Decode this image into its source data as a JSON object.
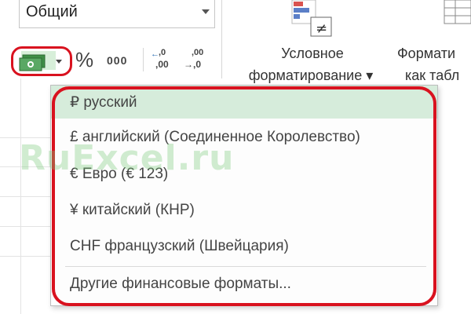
{
  "ribbon": {
    "number_format": {
      "value": "Общий"
    },
    "buttons": {
      "percent": "%",
      "thousands": "000",
      "increase_decimal_top": ",0",
      "increase_decimal_bottom": ",00",
      "decrease_decimal_top": ",00",
      "decrease_decimal_bottom": "→,0"
    },
    "conditional_formatting": {
      "line1": "Условное",
      "line2": "форматирование ▾"
    },
    "format_as_table": {
      "line1": "Формати",
      "line2": "как табл"
    }
  },
  "currency_menu": {
    "items": [
      {
        "label": "₽ русский"
      },
      {
        "label": "£ английский (Соединенное Королевство)"
      },
      {
        "label": "€ Евро (€ 123)"
      },
      {
        "label": "¥ китайский (КНР)"
      },
      {
        "label": "CHF французский (Швейцария)"
      },
      {
        "label": "Другие финансовые форматы..."
      }
    ],
    "highlight_color": "#d6ecdb",
    "outline_color": "#d9121f"
  },
  "watermark": {
    "text": "RuExcel.ru"
  },
  "icons": {
    "currency": "money-bill-icon",
    "dropdown": "chevron-down-icon",
    "conditional": "conditional-formatting-icon",
    "format_table": "table-format-icon"
  }
}
